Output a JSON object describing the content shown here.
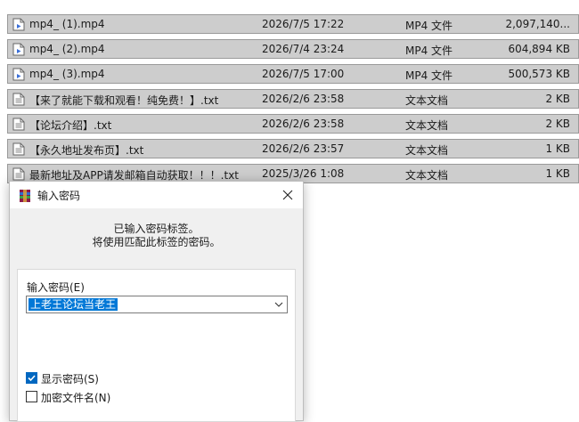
{
  "files": [
    {
      "icon": "video-file-icon",
      "name": "mp4_ (1).mp4",
      "date": "2026/7/5 17:22",
      "type": "MP4 文件",
      "size": "2,097,140..."
    },
    {
      "icon": "video-file-icon",
      "name": "mp4_ (2).mp4",
      "date": "2026/7/4 23:24",
      "type": "MP4 文件",
      "size": "604,894 KB"
    },
    {
      "icon": "video-file-icon",
      "name": "mp4_ (3).mp4",
      "date": "2026/7/5 17:00",
      "type": "MP4 文件",
      "size": "500,573 KB"
    },
    {
      "icon": "text-file-icon",
      "name": "【来了就能下载和观看！纯免费！】.txt",
      "date": "2026/2/6 23:58",
      "type": "文本文档",
      "size": "2 KB"
    },
    {
      "icon": "text-file-icon",
      "name": "【论坛介绍】.txt",
      "date": "2026/2/6 23:58",
      "type": "文本文档",
      "size": "2 KB"
    },
    {
      "icon": "text-file-icon",
      "name": "【永久地址发布页】.txt",
      "date": "2026/2/6 23:57",
      "type": "文本文档",
      "size": "1 KB"
    },
    {
      "icon": "text-file-icon",
      "name": "最新地址及APP请发邮箱自动获取！！！.txt",
      "date": "2025/3/26 1:08",
      "type": "文本文档",
      "size": "1 KB"
    }
  ],
  "dialog": {
    "title": "输入密码",
    "message_line1": "已输入密码标签。",
    "message_line2": "将使用匹配此标签的密码。",
    "password_label": "输入密码(E)",
    "password_value": "上老王论坛当老王",
    "show_password_label": "显示密码(S)",
    "show_password_checked": true,
    "encrypt_filenames_label": "加密文件名(N)",
    "encrypt_filenames_checked": false
  },
  "colors": {
    "row_selected_bg": "#cdcdcd",
    "selection_blue": "#0078d7",
    "checkbox_blue": "#0067c0"
  }
}
